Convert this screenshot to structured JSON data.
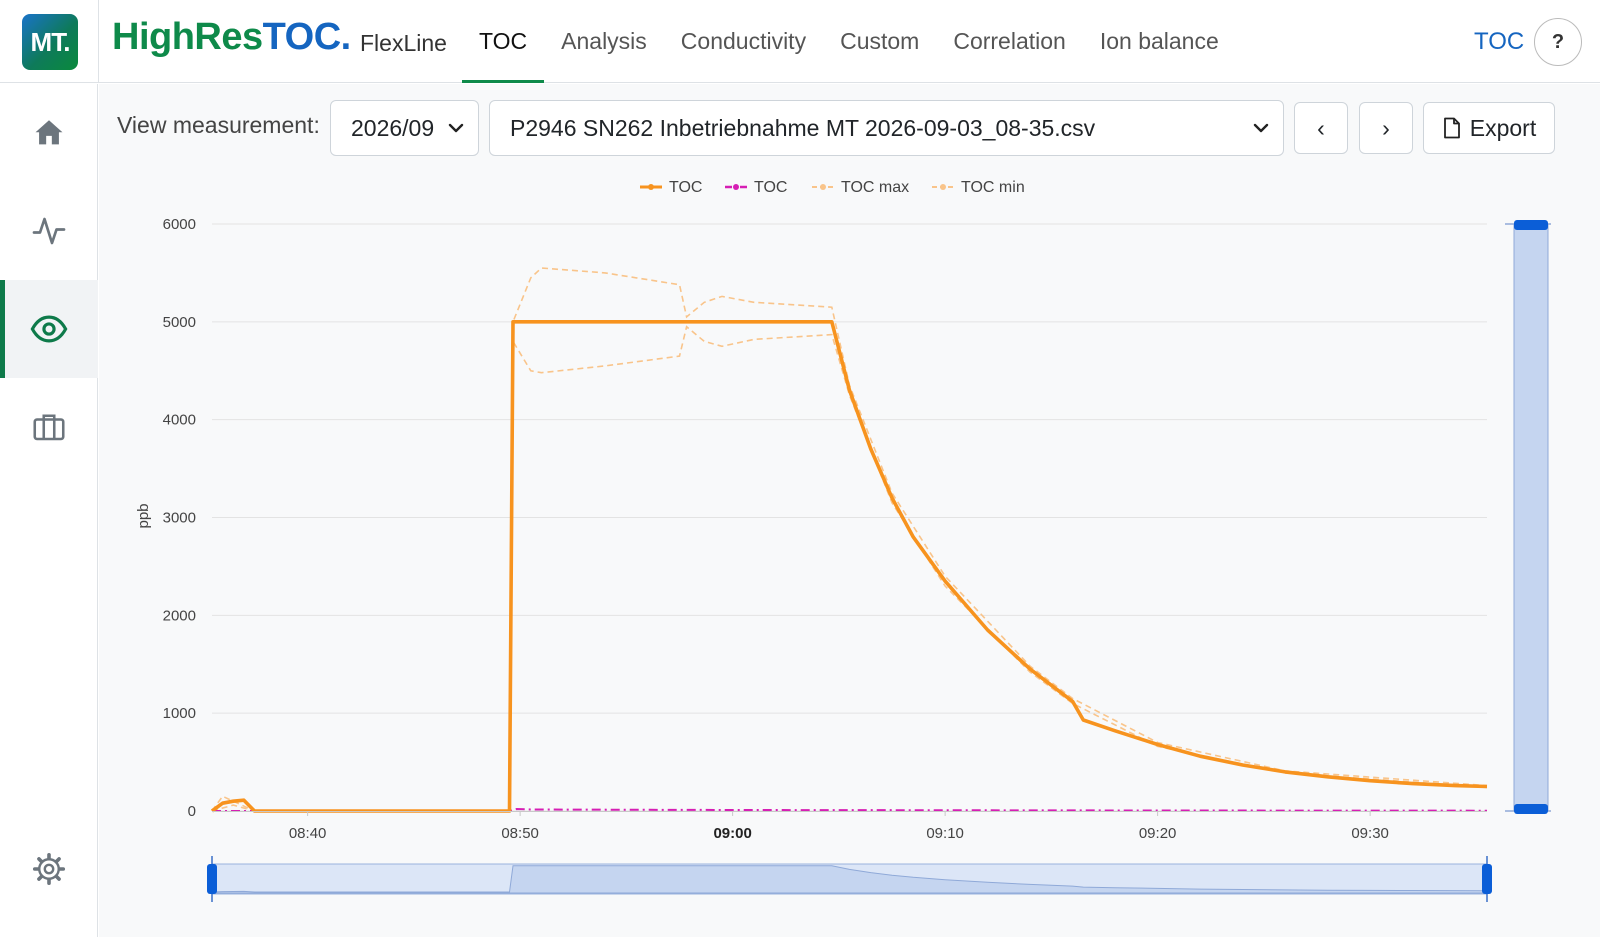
{
  "logo": {
    "text": "MT."
  },
  "brand": {
    "part1": "HighRes",
    "part2": "TOC.",
    "product": "FlexLine"
  },
  "nav": {
    "tabs": [
      "TOC",
      "Analysis",
      "Conductivity",
      "Custom",
      "Correlation",
      "Ion balance"
    ],
    "active": 0
  },
  "topright": {
    "link": "TOC",
    "help": "?"
  },
  "sidebar": {
    "icons": [
      "home-icon",
      "activity-icon",
      "eye-icon",
      "briefcase-icon",
      "gear-icon"
    ],
    "active": 2
  },
  "controls": {
    "view_label": "View measurement:",
    "month_value": "2026/09",
    "file_value": "P2946 SN262 Inbetriebnahme MT 2026-09-03_08-35.csv",
    "prev": "‹",
    "next": "›",
    "export_label": "Export"
  },
  "colors": {
    "toc": "#f7931e",
    "toc2": "#d61fb4",
    "band": "#f9c48a",
    "zoom": "#c5d5f0",
    "handle": "#0b5ed7",
    "accent": "#0e8a4a"
  },
  "chart_data": {
    "type": "line",
    "title": "",
    "xlabel": "",
    "ylabel": "ppb",
    "ylim": [
      0,
      6000
    ],
    "yticks": [
      0,
      1000,
      2000,
      3000,
      4000,
      5000,
      6000
    ],
    "xlim": [
      "08:35:30",
      "09:35:30"
    ],
    "xticks": [
      {
        "t": "08:40",
        "label": "08:40",
        "bold": false
      },
      {
        "t": "08:50",
        "label": "08:50",
        "bold": false
      },
      {
        "t": "09:00",
        "label": "09:00",
        "bold": true
      },
      {
        "t": "09:10",
        "label": "09:10",
        "bold": false
      },
      {
        "t": "09:20",
        "label": "09:20",
        "bold": false
      },
      {
        "t": "09:30",
        "label": "09:30",
        "bold": false
      }
    ],
    "legend": {
      "position": "top-center",
      "entries": [
        "TOC",
        "TOC",
        "TOC max",
        "TOC min"
      ]
    },
    "grid": true,
    "series": [
      {
        "name": "TOC",
        "style": "solid",
        "points": [
          [
            "08:35:30",
            0
          ],
          [
            "08:36:00",
            80
          ],
          [
            "08:36:30",
            100
          ],
          [
            "08:37:00",
            110
          ],
          [
            "08:37:30",
            0
          ],
          [
            "08:49:30",
            0
          ],
          [
            "08:49:40",
            5000
          ],
          [
            "09:04:40",
            5000
          ],
          [
            "09:05:30",
            4300
          ],
          [
            "09:06:30",
            3700
          ],
          [
            "09:07:30",
            3200
          ],
          [
            "09:08:30",
            2800
          ],
          [
            "09:10:00",
            2350
          ],
          [
            "09:12:00",
            1850
          ],
          [
            "09:14:00",
            1450
          ],
          [
            "09:16:00",
            1120
          ],
          [
            "09:16:30",
            930
          ],
          [
            "09:18:00",
            820
          ],
          [
            "09:20:00",
            680
          ],
          [
            "09:22:00",
            560
          ],
          [
            "09:24:00",
            470
          ],
          [
            "09:26:00",
            400
          ],
          [
            "09:28:00",
            350
          ],
          [
            "09:30:00",
            310
          ],
          [
            "09:32:00",
            280
          ],
          [
            "09:34:00",
            260
          ],
          [
            "09:35:30",
            250
          ]
        ]
      },
      {
        "name": "TOC",
        "style": "dash-dot",
        "points": [
          [
            "08:35:30",
            0
          ],
          [
            "08:49:30",
            0
          ],
          [
            "08:49:50",
            20
          ],
          [
            "08:50:30",
            15
          ],
          [
            "09:00:00",
            10
          ],
          [
            "09:20:00",
            5
          ],
          [
            "09:35:30",
            3
          ]
        ]
      },
      {
        "name": "TOC max",
        "style": "dashed",
        "points": [
          [
            "08:35:30",
            0
          ],
          [
            "08:36:00",
            150
          ],
          [
            "08:37:30",
            0
          ],
          [
            "08:49:30",
            0
          ],
          [
            "08:49:40",
            5000
          ],
          [
            "08:50:30",
            5450
          ],
          [
            "08:51:00",
            5550
          ],
          [
            "08:54:00",
            5500
          ],
          [
            "08:57:30",
            5380
          ],
          [
            "08:57:50",
            5050
          ],
          [
            "08:58:40",
            5200
          ],
          [
            "08:59:30",
            5260
          ],
          [
            "09:01:00",
            5200
          ],
          [
            "09:04:40",
            5150
          ],
          [
            "09:05:30",
            4350
          ],
          [
            "09:07:30",
            3250
          ],
          [
            "09:10:00",
            2400
          ],
          [
            "09:14:00",
            1480
          ],
          [
            "09:16:00",
            1150
          ],
          [
            "09:20:00",
            700
          ],
          [
            "09:26:00",
            410
          ],
          [
            "09:35:30",
            260
          ]
        ]
      },
      {
        "name": "TOC min",
        "style": "dashed",
        "points": [
          [
            "08:35:30",
            0
          ],
          [
            "08:36:30",
            60
          ],
          [
            "08:37:30",
            0
          ],
          [
            "08:49:30",
            0
          ],
          [
            "08:49:40",
            4800
          ],
          [
            "08:50:30",
            4500
          ],
          [
            "08:51:00",
            4480
          ],
          [
            "08:54:00",
            4550
          ],
          [
            "08:57:30",
            4650
          ],
          [
            "08:57:50",
            4950
          ],
          [
            "08:58:40",
            4800
          ],
          [
            "08:59:30",
            4750
          ],
          [
            "09:01:00",
            4820
          ],
          [
            "09:04:40",
            4870
          ],
          [
            "09:05:30",
            4250
          ],
          [
            "09:07:30",
            3150
          ],
          [
            "09:10:00",
            2300
          ],
          [
            "09:14:00",
            1420
          ],
          [
            "09:16:00",
            1100
          ],
          [
            "09:20:00",
            660
          ],
          [
            "09:26:00",
            390
          ],
          [
            "09:35:30",
            240
          ]
        ]
      }
    ]
  }
}
